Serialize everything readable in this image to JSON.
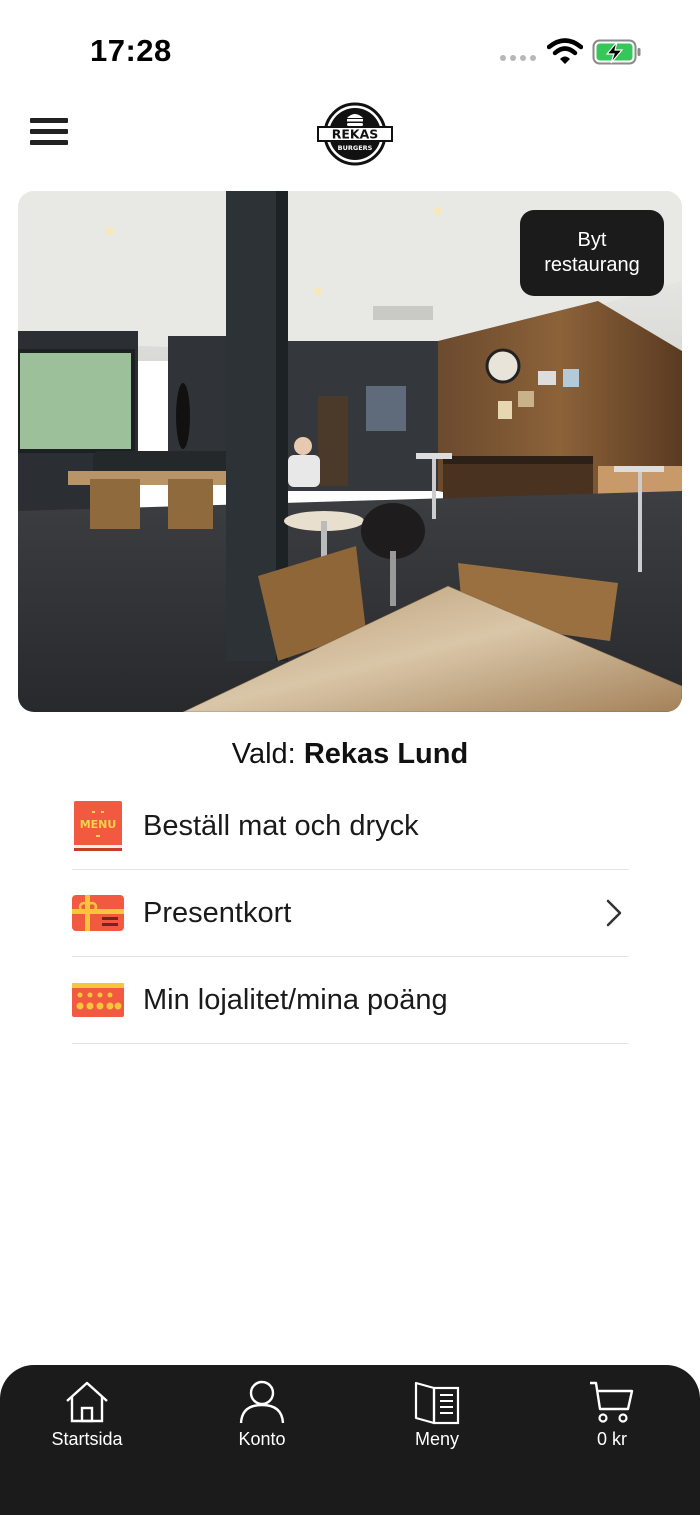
{
  "status_bar": {
    "time": "17:28"
  },
  "header": {
    "logo_text": "REKAS",
    "logo_subtext": "BURGERS"
  },
  "hero": {
    "change_restaurant_label": "Byt restaurang"
  },
  "selected": {
    "prefix": "Vald:",
    "name": "Rekas Lund"
  },
  "menu_items": [
    {
      "label": "Beställ mat och dryck",
      "icon": "menu-book-icon",
      "icon_text": "MENU",
      "chevron": false
    },
    {
      "label": "Presentkort",
      "icon": "gift-card-icon",
      "chevron": true
    },
    {
      "label": "Min lojalitet/mina poäng",
      "icon": "loyalty-card-icon",
      "chevron": false
    }
  ],
  "tabbar": {
    "items": [
      {
        "label": "Startsida",
        "icon": "home-icon"
      },
      {
        "label": "Konto",
        "icon": "account-icon"
      },
      {
        "label": "Meny",
        "icon": "menu-icon"
      },
      {
        "label": "0 kr",
        "icon": "cart-icon"
      }
    ]
  },
  "colors": {
    "accent": "#f15a40",
    "dark": "#1b1b1b",
    "battery": "#35c759"
  }
}
